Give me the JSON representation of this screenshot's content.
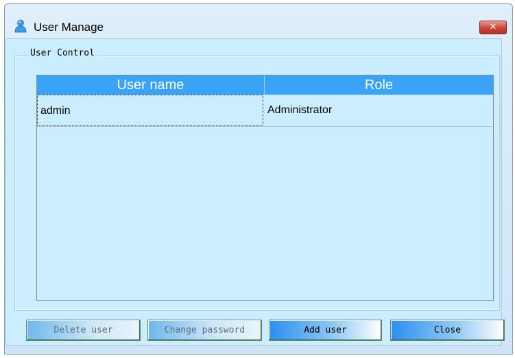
{
  "window": {
    "title": "User Manage",
    "close_glyph": "✕",
    "icon": "user-icon"
  },
  "group": {
    "label": "User Control"
  },
  "table": {
    "columns": [
      "User name",
      "Role"
    ],
    "rows": [
      {
        "username": "admin",
        "role": "Administrator"
      }
    ]
  },
  "buttons": {
    "delete": "Delete user",
    "change_password": "Change password",
    "add": "Add user",
    "close": "Close"
  },
  "colors": {
    "header_bg": "#3aa3f5",
    "client_bg": "#cbeeff",
    "close_button": "#c9463a"
  }
}
